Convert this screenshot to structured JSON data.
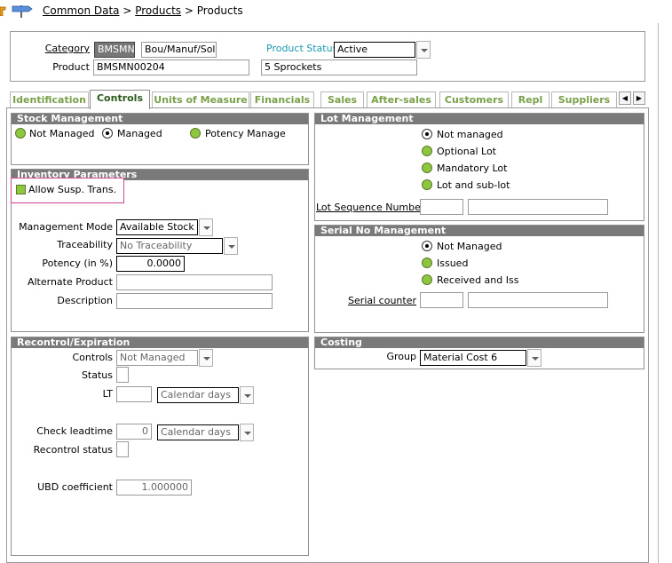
{
  "breadcrumb": {
    "part1": "Common Data",
    "sep1": ">",
    "part2": "Products",
    "sep2": ">",
    "part3": "Products"
  },
  "header": {
    "category_label": "Category",
    "category_code": "BMSMN",
    "category_name": "Bou/Manuf/Sol",
    "status_label": "Product Status",
    "status_value": "Active",
    "product_label": "Product",
    "product_code": "BMSMN00204",
    "product_name": "5 Sprockets"
  },
  "tabs": [
    {
      "label": "Identification",
      "active": false
    },
    {
      "label": "Controls",
      "active": true
    },
    {
      "label": "Units of Measure",
      "active": false
    },
    {
      "label": "Financials",
      "active": false
    },
    {
      "label": "Sales",
      "active": false
    },
    {
      "label": "After-sales",
      "active": false
    },
    {
      "label": "Customers",
      "active": false
    },
    {
      "label": "Repl",
      "active": false
    },
    {
      "label": "Suppliers",
      "active": false
    }
  ],
  "stock": {
    "title": "Stock Management",
    "opt1": "Not Managed",
    "opt2": "Managed",
    "opt3": "Potency Manage",
    "selected": "Managed"
  },
  "inventory": {
    "title": "Inventory Parameters",
    "allow_susp": "Allow Susp. Trans.",
    "mgmt_mode_label": "Management Mode",
    "mgmt_mode_value": "Available Stock",
    "traceability_label": "Traceability",
    "traceability_value": "No Traceability",
    "potency_label": "Potency (in %)",
    "potency_value": "0.0000",
    "alt_product_label": "Alternate Product",
    "alt_product_value": "",
    "description_label": "Description",
    "description_value": ""
  },
  "recontrol": {
    "title": "Recontrol/Expiration",
    "controls_label": "Controls",
    "controls_value": "Not Managed",
    "status_label": "Status",
    "lt_label": "LT",
    "lt_value": "",
    "lt_unit": "Calendar days",
    "check_label": "Check leadtime",
    "check_value": "0",
    "check_unit": "Calendar days",
    "recontrol_status_label": "Recontrol status",
    "ubd_label": "UBD coefficient",
    "ubd_value": "1.000000"
  },
  "lot": {
    "title": "Lot Management",
    "opt1": "Not managed",
    "opt2": "Optional Lot",
    "opt3": "Mandatory Lot",
    "opt4": "Lot and sub-lot",
    "selected": "Not managed",
    "seq_label": "Lot Sequence Number"
  },
  "serial": {
    "title": "Serial No Management",
    "opt1": "Not Managed",
    "opt2": "Issued",
    "opt3": "Received and Iss",
    "selected": "Not Managed",
    "counter_label": "Serial counter"
  },
  "costing": {
    "title": "Costing",
    "group_label": "Group",
    "group_value": "Material Cost 6"
  },
  "colors": {
    "tab_text": "#7aa04a",
    "radio_green": "#8ec63f",
    "panel_title": "#7a7a7a",
    "highlight": "#d64090"
  },
  "icons": {
    "home": "wrench-icon",
    "nav": "signpost-icon"
  }
}
